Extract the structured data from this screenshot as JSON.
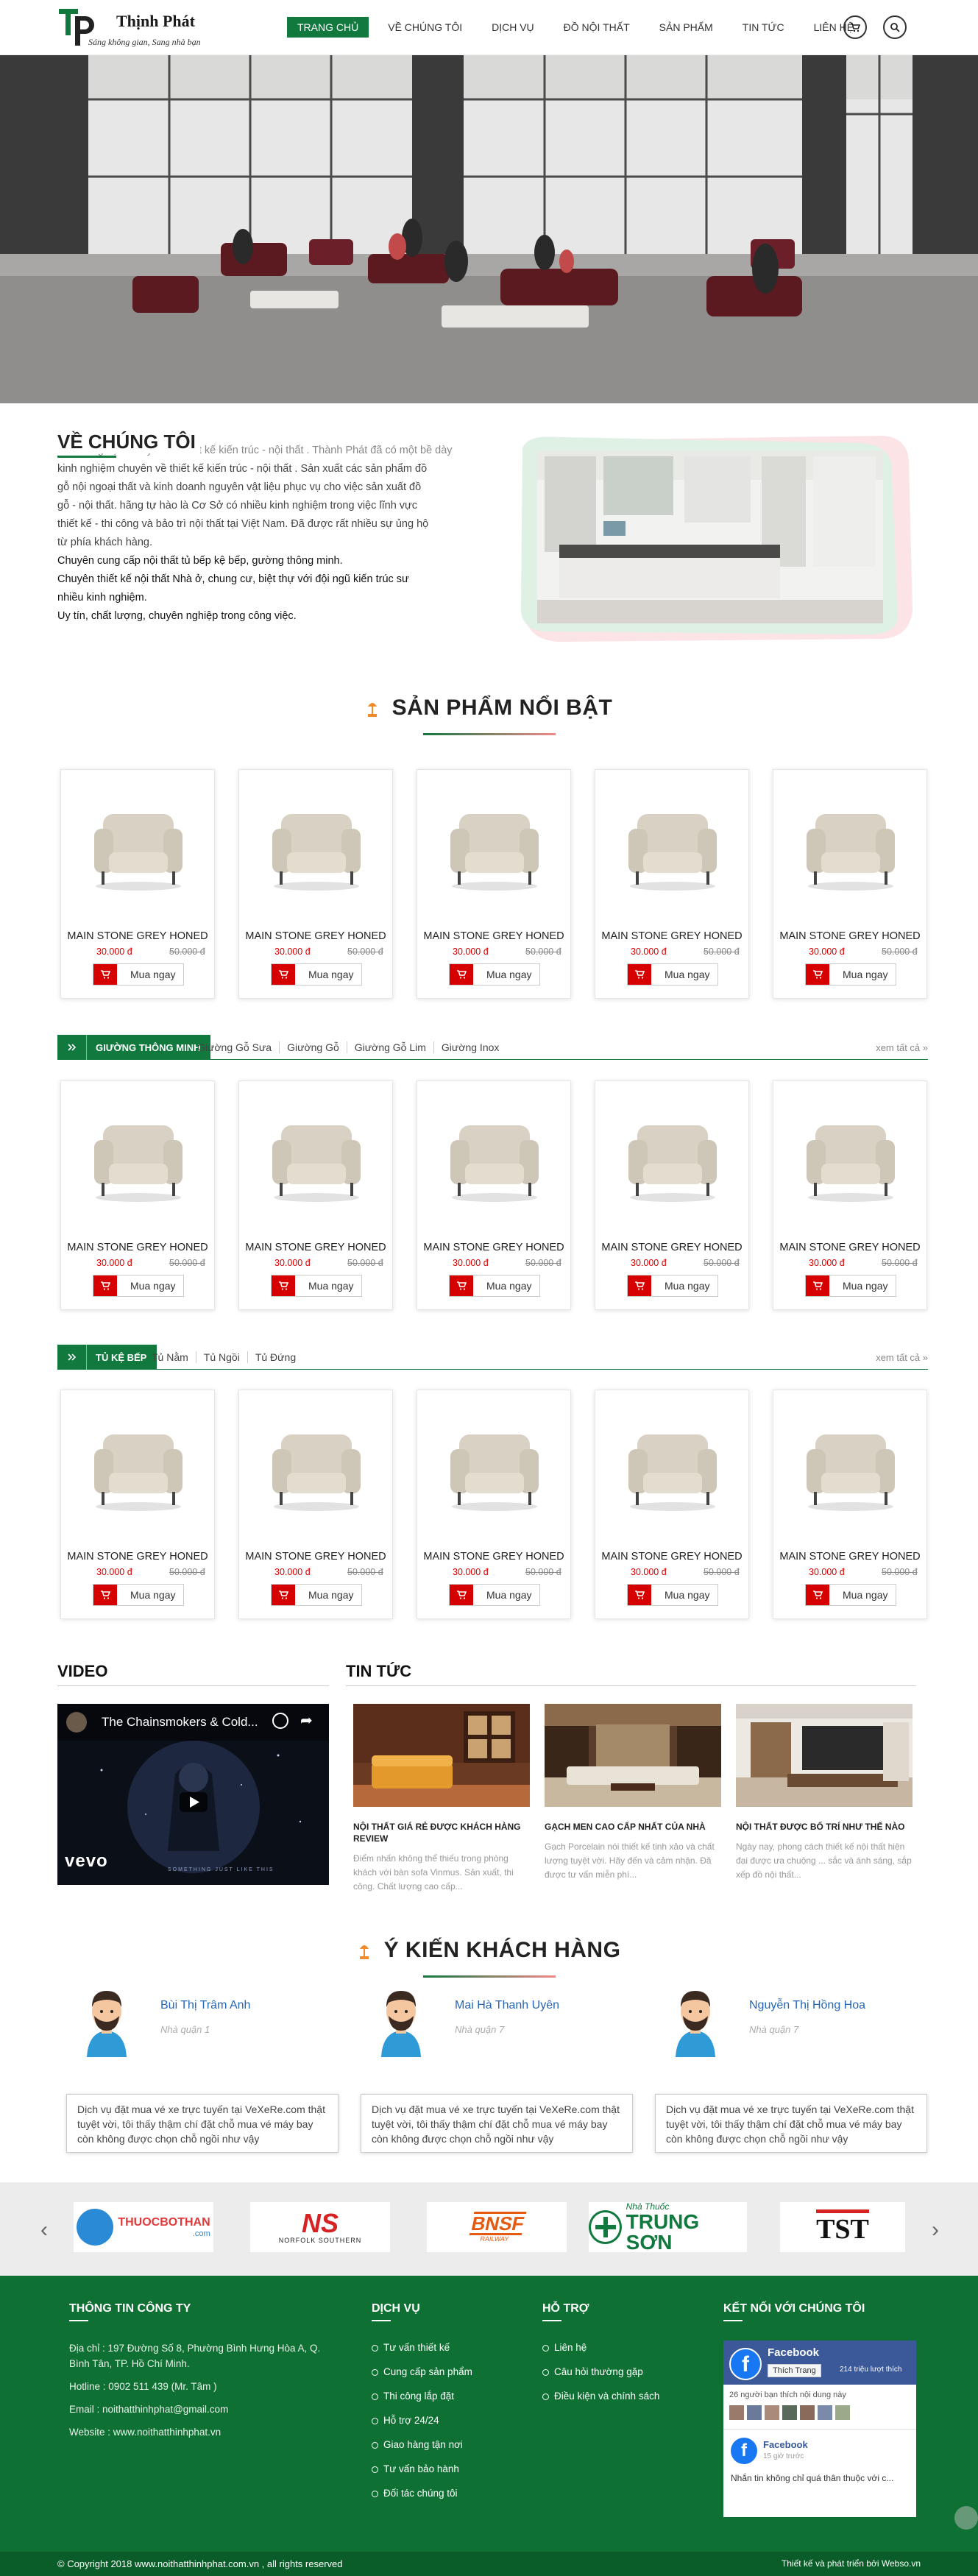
{
  "header": {
    "brand": "Thịnh Phát",
    "tagline": "Sáng không gian, Sang nhà bạn",
    "nav": [
      "TRANG CHỦ",
      "VỀ CHÚNG TÔI",
      "DỊCH VỤ",
      "ĐỒ NỘI THẤT",
      "SẢN PHẨM",
      "TIN TỨC",
      "LIÊN HỆ"
    ],
    "icons": [
      "cart-icon",
      "search-icon"
    ]
  },
  "about": {
    "title": "VỀ CHÚNG TÔI",
    "lines": [
      "... kinh nghiệm chuyên về thiết kế kiến trúc - nội thất . Thành Phát đã có một bề dày",
      "kinh nghiệm chuyên về thiết kế kiến trúc - nội thất . Sản xuất các sản phẩm đồ",
      "gỗ nội ngoại thất và kinh doanh nguyên vật liệu phục vụ cho việc sản xuất đồ",
      "gỗ - nội thất. hãng tự hào là Cơ Sở có nhiều kinh nghiệm trong việc lĩnh vực",
      "thiết kế - thi công và bảo trì nội thất tại Việt Nam. Đã được rất nhiều sự ủng hộ",
      "từ phía khách hàng.",
      " Chuyên cung cấp nội thất tủ bếp kệ bếp, gường thông minh.",
      " Chuyên thiết kế nội thất Nhà ở, chung cư, biệt thự với đội ngũ kiến trúc sư",
      "nhiều kinh nghiệm.",
      " Uy tín, chất lượng, chuyên nghiệp trong công việc."
    ]
  },
  "featured": {
    "title": "SẢN PHẨM NỔI BẬT"
  },
  "product": {
    "name": "MAIN STONE GREY HONED",
    "price": "30.000 đ",
    "old_price": "50.000 đ",
    "buy_label": "Mua ngay"
  },
  "categories": [
    {
      "label": "GIƯỜNG THÔNG MINH",
      "subs": [
        "Giường Gỗ Sưa",
        "Giường Gỗ",
        "Giường Gỗ Lim",
        "Giường Inox"
      ],
      "more": "xem tất cả »"
    },
    {
      "label": "TỦ KỆ BẾP",
      "subs": [
        "Tủ Nằm",
        "Tủ Ngồi",
        "Tủ Đứng"
      ],
      "more": "xem tất cả »"
    }
  ],
  "video": {
    "title": "VIDEO",
    "clip_title": "The Chainsmokers & Cold...",
    "brand": "vevo",
    "caption": "SOMETHING JUST LIKE THIS"
  },
  "news": {
    "title": "TIN TỨC",
    "items": [
      {
        "title": "NỘI THẤT GIÁ RẺ ĐƯỢC KHÁCH HÀNG REVIEW",
        "desc": "Điểm nhấn không thể thiếu trong phòng khách với bàn sofa Vinmus. Sản xuất, thi công. Chất lượng cao cấp..."
      },
      {
        "title": "GẠCH MEN CAO CẤP NHẤT CỦA NHÀ",
        "desc": "Gạch Porcelain nói thiết kế tinh xảo và chất lượng tuyệt vời. Hãy đến và cảm nhận. Đã được tư vấn miễn phí..."
      },
      {
        "title": "NỘI THẤT ĐƯỢC BỐ TRÍ NHƯ THẾ NÀO",
        "desc": "Ngày nay, phong cách thiết kế nội thất hiện đại được ưa chuộng ... sắc và ánh sáng, sắp xếp đồ nội thất..."
      }
    ]
  },
  "testimonials": {
    "title": "Ý KIẾN KHÁCH HÀNG",
    "items": [
      {
        "name": "Bùi Thị Trâm Anh",
        "role": "Nhà quận 1",
        "text": "Dịch vụ đặt mua vé xe trực tuyến tại VeXeRe.com thật tuyệt vời, tôi thấy thậm chí đặt chỗ mua vé máy bay còn không được chọn chỗ ngồi như vậy"
      },
      {
        "name": "Mai Hà Thanh Uyên",
        "role": "Nhà quận 7",
        "text": "Dịch vụ đặt mua vé xe trực tuyến tại VeXeRe.com thật tuyệt vời, tôi thấy thậm chí đặt chỗ mua vé máy bay còn không được chọn chỗ ngồi như vậy"
      },
      {
        "name": "Nguyễn Thị Hồng Hoa",
        "role": "Nhà quận 7",
        "text": "Dịch vụ đặt mua vé xe trực tuyến tại VeXeRe.com thật tuyệt vời, tôi thấy thậm chí đặt chỗ mua vé máy bay còn không được chọn chỗ ngồi như vậy"
      }
    ]
  },
  "partners": [
    {
      "name": "THUOCBOTHAN",
      "sub": ".com"
    },
    {
      "name": "NS",
      "sub": "NORFOLK SOUTHERN"
    },
    {
      "name": "BNSF",
      "sub": "RAILWAY"
    },
    {
      "name": "TRUNG SƠN",
      "sub": "Nhà Thuốc"
    },
    {
      "name": "TST",
      "sub": ""
    }
  ],
  "footer": {
    "company_title": "THÔNG TIN CÔNG TY",
    "address": "Địa chỉ : 197 Đường Số 8, Phường Bình Hưng Hòa A, Q. Bình Tân, TP. Hồ Chí Minh.",
    "hotline": "Hotline : 0902 511 439   (Mr. Tâm )",
    "email": "Email : noithatthinhphat@gmail.com",
    "website": "Website : www.noithatthinhphat.vn",
    "service_title": "DỊCH VỤ",
    "services": [
      "Tư vấn thiết kế",
      "Cung cấp sản phẩm",
      "Thi công lắp đặt",
      "Hỗ trợ 24/24",
      "Giao hàng tận nơi",
      "Tư vấn bảo hành",
      "Đối tác chúng tôi"
    ],
    "support_title": "HỖ TRỢ",
    "supports": [
      "Liên hệ",
      "Câu hỏi thường gặp",
      "Điều kiện và chính sách"
    ],
    "connect_title": "KẾT NỐI VỚI CHÚNG TÔI",
    "fb_name": "Facebook",
    "fb_likes_btn": "Thích Trang",
    "fb_likes": "214 triệu lượt thích",
    "fb_friends": "26 người bạn thích nội dung này",
    "fb_post_name": "Facebook",
    "fb_post_time": "15 giờ trước",
    "fb_post_text": "Nhắn tin không chỉ quá thân thuộc với c..."
  },
  "copyright": {
    "left": "© Copyright 2018 www.noithatthinhphat.com.vn , all rights reserved",
    "right": "Thiết kế và phát triển bởi Webso.vn"
  },
  "colors": {
    "brand_green": "#11783e",
    "footer_green": "#0e7033",
    "price_red": "#d60000",
    "link_blue": "#2566b8"
  }
}
